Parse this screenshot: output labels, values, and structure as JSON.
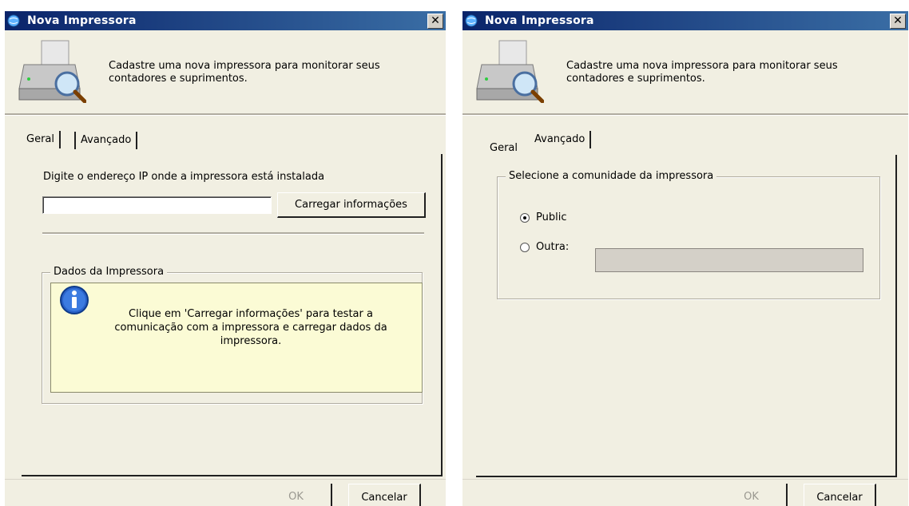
{
  "windows": [
    {
      "title": "Nova Impressora",
      "close_symbol": "✕",
      "header_text": "Cadastre uma nova impressora para monitorar seus contadores e suprimentos.",
      "tabs": [
        {
          "label": "Geral",
          "active": true
        },
        {
          "label": "Avançado",
          "active": false
        }
      ],
      "ip_label": "Digite o endereço IP onde a impressora está instalada",
      "ip_value": "",
      "load_button": "Carregar informações",
      "group_title": "Dados da Impressora",
      "info_message": "Clique em 'Carregar informações' para testar a comunicação com a impressora e carregar dados da impressora.",
      "ok_button": "OK",
      "cancel_button": "Cancelar"
    },
    {
      "title": "Nova Impressora",
      "close_symbol": "✕",
      "header_text": "Cadastre uma nova impressora para monitorar seus contadores e suprimentos.",
      "tabs": [
        {
          "label": "Geral",
          "active": false
        },
        {
          "label": "Avançado",
          "active": true
        }
      ],
      "group_title": "Selecione a comunidade da impressora",
      "radio_options": [
        {
          "label": "Public",
          "checked": true
        },
        {
          "label": "Outra:",
          "checked": false
        }
      ],
      "outra_value": "",
      "ok_button": "OK",
      "cancel_button": "Cancelar"
    }
  ],
  "icons": {
    "title": "globe-app-icon",
    "header": "printer-magnifier-icon",
    "info": "info-icon"
  },
  "colors": {
    "titlebar_start": "#0a246a",
    "titlebar_end": "#3a6ea5",
    "dialog_bg": "#f1efe2",
    "info_bg": "#fbfbd5"
  }
}
